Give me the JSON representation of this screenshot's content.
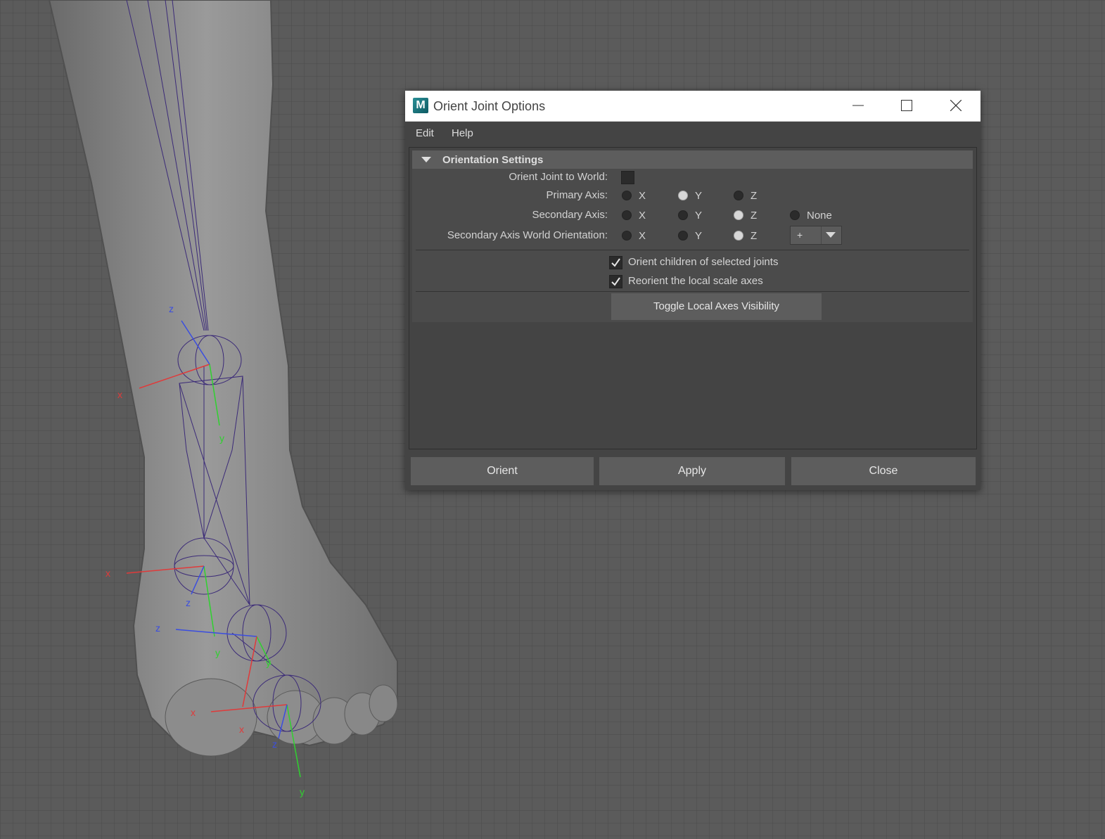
{
  "viewport": {
    "axis_labels": {
      "x": "x",
      "y": "y",
      "z": "z"
    },
    "colors": {
      "x_axis": "#e03a3a",
      "y_axis": "#2fd12f",
      "z_axis": "#3a4de0",
      "bone": "#3b2a78",
      "skin": "#8a8a8a",
      "floor": "#5b5b5b"
    }
  },
  "window": {
    "title": "Orient Joint Options",
    "app_icon_glyph": "M",
    "controls": [
      "minimize-icon",
      "maximize-icon",
      "close-icon"
    ]
  },
  "menu": {
    "edit": "Edit",
    "help": "Help"
  },
  "section": {
    "title": "Orientation Settings",
    "expanded": true
  },
  "orient_world": {
    "label": "Orient Joint to World:",
    "checked": false
  },
  "primary_axis": {
    "label": "Primary Axis:",
    "options": [
      "X",
      "Y",
      "Z"
    ],
    "selected": "Y"
  },
  "secondary_axis": {
    "label": "Secondary Axis:",
    "options": [
      "X",
      "Y",
      "Z",
      "None"
    ],
    "selected": "Z"
  },
  "secondary_world": {
    "label": "Secondary Axis World Orientation:",
    "options": [
      "X",
      "Y",
      "Z"
    ],
    "selected": "Z",
    "sign": "+"
  },
  "options": {
    "orient_children": {
      "label": "Orient children of selected joints",
      "checked": true
    },
    "reorient_scale": {
      "label": "Reorient the local scale axes",
      "checked": true
    }
  },
  "toggle_button": "Toggle Local Axes Visibility",
  "buttons": {
    "orient": "Orient",
    "apply": "Apply",
    "close": "Close"
  }
}
